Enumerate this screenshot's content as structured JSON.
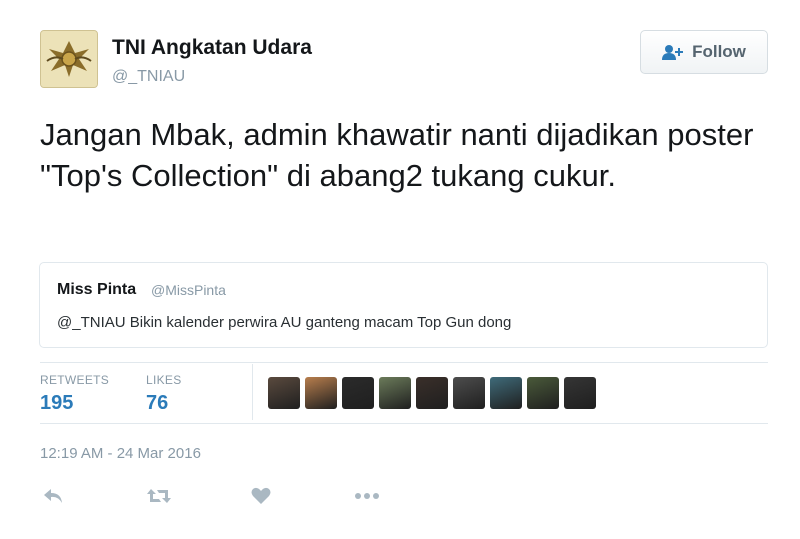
{
  "author": {
    "display_name": "TNI Angkatan Udara",
    "handle": "@_TNIAU"
  },
  "follow_button": {
    "label": "Follow",
    "icon": "follow-user-icon"
  },
  "tweet": {
    "text": "Jangan Mbak, admin khawatir nanti dijadikan poster \"Top's Collection\" di abang2 tukang cukur."
  },
  "quoted_tweet": {
    "display_name": "Miss Pinta",
    "handle": "@MissPinta",
    "text": "@_TNIAU Bikin kalender perwira AU ganteng macam Top Gun dong"
  },
  "stats": {
    "retweets_label": "RETWEETS",
    "retweets_count": "195",
    "likes_label": "LIKES",
    "likes_count": "76"
  },
  "likers": [
    {
      "color": "#5a4a3e"
    },
    {
      "color": "#b87e4d"
    },
    {
      "color": "#2b2b2b"
    },
    {
      "color": "#6b7b5a"
    },
    {
      "color": "#3a2f2a"
    },
    {
      "color": "#4d4d4d"
    },
    {
      "color": "#3f6b7a"
    },
    {
      "color": "#4a5a3a"
    },
    {
      "color": "#353535"
    }
  ],
  "timestamp": "12:19 AM - 24 Mar 2016",
  "actions": [
    "reply-icon",
    "retweet-icon",
    "like-heart-icon",
    "more-dots-icon"
  ],
  "colors": {
    "accent": "#2b7bb9",
    "muted": "#8899a6",
    "border": "#e1e8ed"
  }
}
